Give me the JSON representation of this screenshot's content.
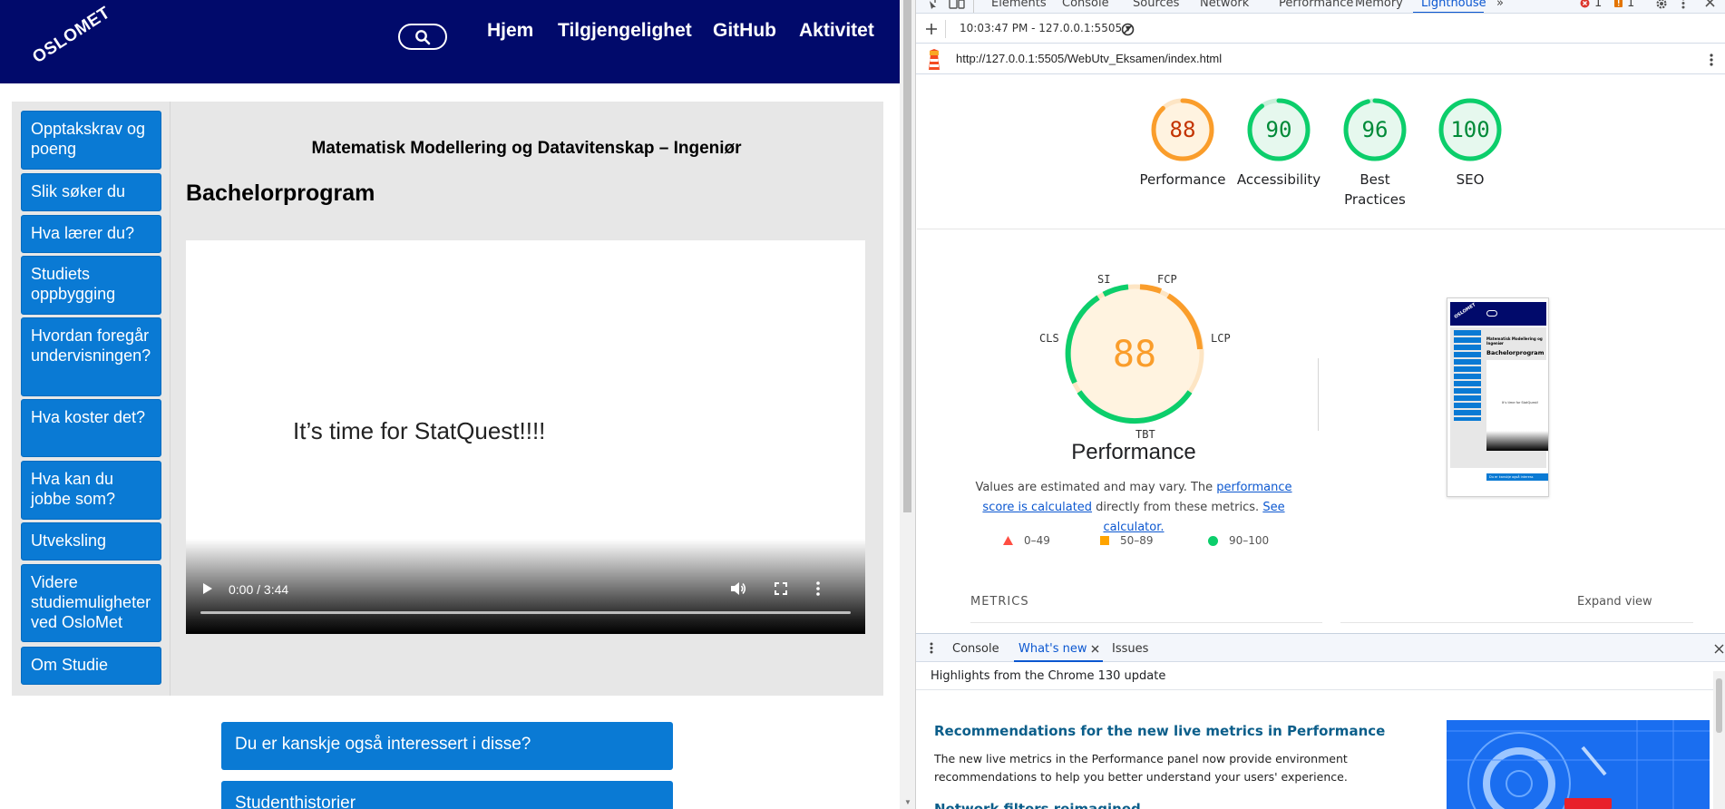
{
  "site": {
    "logo_text": "OSLOMET",
    "nav": [
      "Hjem",
      "Tilgjengelighet",
      "GitHub",
      "Aktivitet"
    ],
    "sidebar": [
      "Opptakskrav og poeng",
      "Slik søker du",
      "Hva lærer du?",
      "Studiets oppbygging",
      "Hvordan foregår undervisningen?",
      "Hva koster det?",
      "Hva kan du jobbe som?",
      "Utveksling",
      "Videre studiemuligheter ved OsloMet",
      "Om Studie"
    ],
    "subtitle": "Matematisk Modellering og Datavitenskap – Ingeniør",
    "heading": "Bachelorprogram",
    "video": {
      "caption": "It’s time for StatQuest!!!!",
      "time": "0:00 / 3:44"
    },
    "cta_buttons": [
      "Du er kanskje også interessert i disse?",
      "Studenthistorier"
    ]
  },
  "devtools": {
    "tabs": [
      "Elements",
      "Console",
      "Sources",
      "Network",
      "Performance",
      "Memory",
      "Lighthouse"
    ],
    "active_tab": "Lighthouse",
    "error_count": "1",
    "warning_count": "1",
    "report_selector": "10:03:47 PM - 127.0.0.1:5505",
    "url": "http://127.0.0.1:5505/WebUtv_Eksamen/index.html",
    "scores": [
      {
        "label": "Performance",
        "value": "88",
        "color": "#fa9d2b"
      },
      {
        "label": "Accessibility",
        "value": "90",
        "color": "#0cce6b"
      },
      {
        "label": "Best Practices",
        "value": "96",
        "color": "#0cce6b"
      },
      {
        "label": "SEO",
        "value": "100",
        "color": "#0cce6b"
      }
    ],
    "perf_gauge": {
      "score": "88",
      "title": "Performance",
      "segments": [
        "SI",
        "FCP",
        "LCP",
        "TBT",
        "CLS"
      ]
    },
    "note": {
      "prefix": "Values are estimated and may vary. The ",
      "link1": "performance score is calculated",
      "middle": " directly from these metrics. ",
      "link2": "See calculator."
    },
    "legend": [
      {
        "range": "0–49",
        "color": "#ff4e42"
      },
      {
        "range": "50–89",
        "color": "#ffa400"
      },
      {
        "range": "90–100",
        "color": "#0cce6b"
      }
    ],
    "thumb": {
      "subtitle": "Matematisk Modellering og Ingeniør",
      "heading": "Bachelorprogram",
      "caption": "It’s time for StatQuest!",
      "cta": "Du er kanskje også interess"
    },
    "metrics_label": "METRICS",
    "expand_view": "Expand view",
    "drawer_tabs": [
      "Console",
      "What's new",
      "Issues"
    ],
    "drawer_active": "What's new",
    "highlights": "Highlights from the Chrome 130 update",
    "whats_new": [
      {
        "heading": "Recommendations for the new live metrics in Performance",
        "text": "The new live metrics in the Performance panel now provide environment recommendations to help you better understand your users' experience."
      },
      {
        "heading": "Network filters reimagined"
      }
    ]
  }
}
